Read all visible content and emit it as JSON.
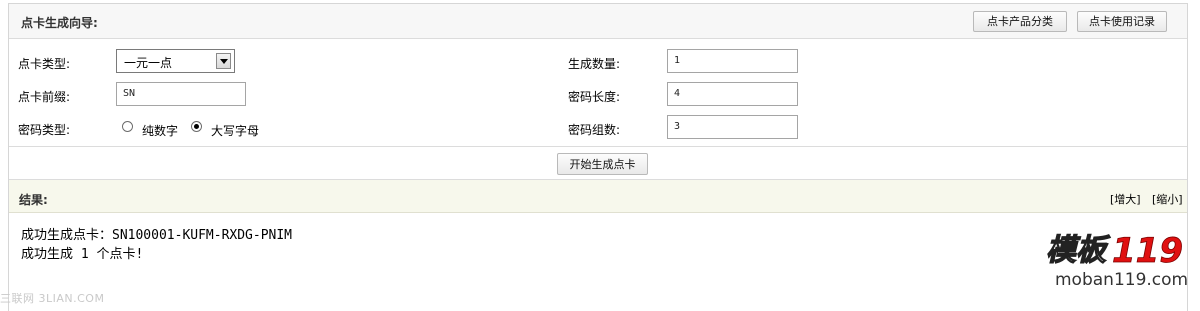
{
  "header": {
    "title": "点卡生成向导:",
    "category_button": "点卡产品分类",
    "usage_log_button": "点卡使用记录"
  },
  "form": {
    "card_type": {
      "label": "点卡类型:",
      "selected": "一元一点"
    },
    "card_prefix": {
      "label": "点卡前缀:",
      "value": "SN"
    },
    "password_type": {
      "label": "密码类型:",
      "options": [
        {
          "label": "纯数字",
          "checked": false
        },
        {
          "label": "大写字母",
          "checked": true
        }
      ]
    },
    "quantity": {
      "label": "生成数量:",
      "value": "1"
    },
    "password_length": {
      "label": "密码长度:",
      "value": "4"
    },
    "password_groups": {
      "label": "密码组数:",
      "value": "3"
    },
    "start_button": "开始生成点卡"
  },
  "result": {
    "title": "结果:",
    "zoom_in": "[增大]",
    "zoom_out": "[缩小]",
    "lines": [
      "成功生成点卡：SN100001-KUFM-RXDG-PNIM",
      "成功生成 1 个点卡!"
    ]
  },
  "watermarks": {
    "left": "三联网 3LIAN.COM",
    "logo_text": "模板119",
    "logo_site": "moban119.com"
  },
  "colors": {
    "header_bg": "#f7f7f7",
    "result_header_bg": "#f7f8ec",
    "logo_red": "#e01010"
  }
}
